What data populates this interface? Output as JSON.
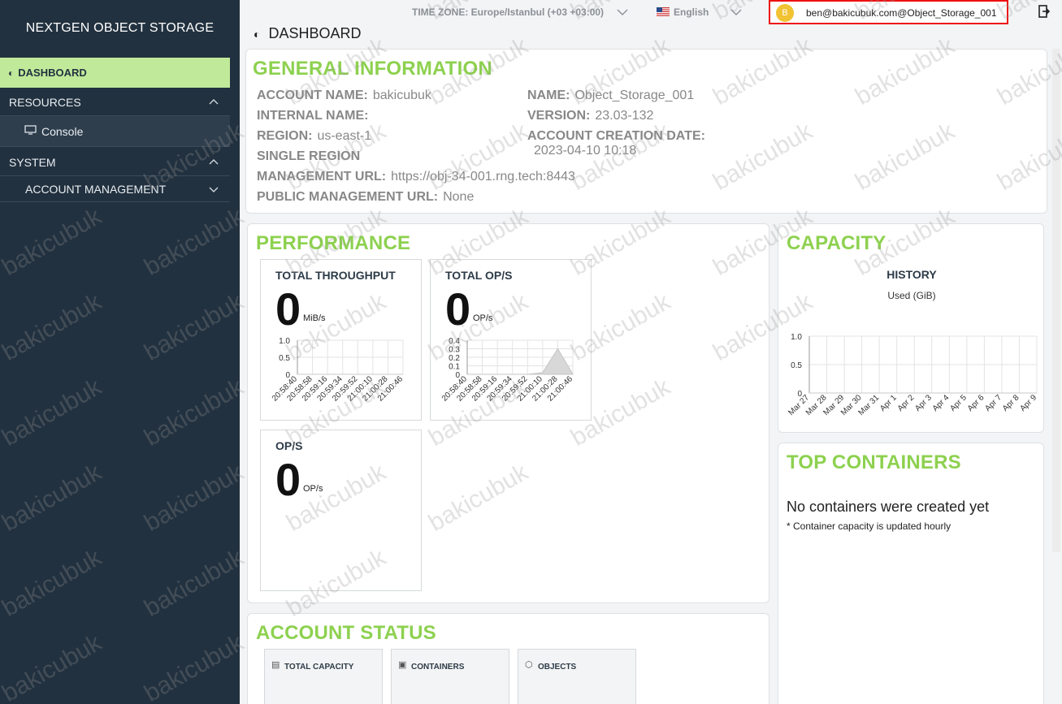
{
  "sidebar": {
    "brand": "NEXTGEN OBJECT STORAGE",
    "dashboard": "DASHBOARD",
    "resources": "RESOURCES",
    "console": "Console",
    "system": "SYSTEM",
    "account_management": "ACCOUNT MANAGEMENT"
  },
  "topbar": {
    "timezone": "TIME ZONE: Europe/Istanbul (+03 +03:00)",
    "language": "English",
    "avatar_letter": "B",
    "user": "ben@bakicubuk.com@Object_Storage_001"
  },
  "page_title": "DASHBOARD",
  "general": {
    "title": "GENERAL INFORMATION",
    "account_name_label": "ACCOUNT NAME:",
    "account_name": "bakicubuk",
    "internal_name_label": "INTERNAL NAME:",
    "region_label": "REGION:",
    "region": "us-east-1",
    "single_region": "SINGLE REGION",
    "mgmt_url_label": "MANAGEMENT URL:",
    "mgmt_url": "https://obj-34-001.rng.tech:8443",
    "public_url_label": "PUBLIC MANAGEMENT URL:",
    "public_url": "None",
    "name_label": "NAME:",
    "name": "Object_Storage_001",
    "version_label": "VERSION:",
    "version": "23.03-132",
    "creation_label": "ACCOUNT CREATION DATE:",
    "creation": "2023-04-10 10:18"
  },
  "performance": {
    "title": "PERFORMANCE",
    "throughput": {
      "title": "TOTAL THROUGHPUT",
      "value": "0",
      "unit": "MiB/s"
    },
    "total_ops": {
      "title": "TOTAL OP/S",
      "value": "0",
      "unit": "OP/s"
    },
    "ops": {
      "title": "OP/S",
      "value": "0",
      "unit": "OP/s"
    }
  },
  "capacity": {
    "title": "CAPACITY",
    "history": "HISTORY",
    "used": "Used (GiB)"
  },
  "top_containers": {
    "title": "TOP CONTAINERS",
    "message": "No containers were created yet",
    "note": "* Container capacity is updated hourly"
  },
  "account_status": {
    "title": "ACCOUNT STATUS",
    "total_capacity": "TOTAL CAPACITY",
    "containers": "CONTAINERS",
    "objects": "OBJECTS"
  },
  "watermark": "bakicubuk",
  "chart_data": [
    {
      "type": "line",
      "x": [
        "20:58:40",
        "20:58:58",
        "20:59:16",
        "20:59:34",
        "20:59:52",
        "21:00:10",
        "21:00:28",
        "21:00:46"
      ],
      "series": [
        {
          "values": [
            0,
            0,
            0,
            0,
            0,
            0,
            0,
            0
          ]
        }
      ],
      "yticks": [
        "1.0",
        "0.5",
        "0"
      ],
      "ylim": [
        0,
        1.0
      ],
      "grid": true
    },
    {
      "type": "area",
      "x": [
        "20:58:40",
        "20:58:58",
        "20:59:16",
        "20:59:34",
        "20:59:52",
        "21:00:10",
        "21:00:28",
        "21:00:46"
      ],
      "series": [
        {
          "values": [
            0,
            0,
            0,
            0,
            0,
            0.02,
            0.3,
            0
          ]
        }
      ],
      "yticks": [
        "0.4",
        "0.3",
        "0.2",
        "0.1",
        "0"
      ],
      "ylim": [
        0,
        0.4
      ],
      "grid": true
    },
    {
      "type": "line",
      "x": [
        "Mar 27",
        "Mar 28",
        "Mar 29",
        "Mar 30",
        "Mar 31",
        "Apr 1",
        "Apr 2",
        "Apr 3",
        "Apr 4",
        "Apr 5",
        "Apr 6",
        "Apr 7",
        "Apr 8",
        "Apr 9"
      ],
      "series": [
        {
          "values": [
            0,
            0,
            0,
            0,
            0,
            0,
            0,
            0,
            0,
            0,
            0,
            0,
            0,
            0
          ]
        }
      ],
      "yticks": [
        "1.0",
        "0.5",
        "0"
      ],
      "ylim": [
        0,
        1.0
      ],
      "grid": true
    }
  ]
}
